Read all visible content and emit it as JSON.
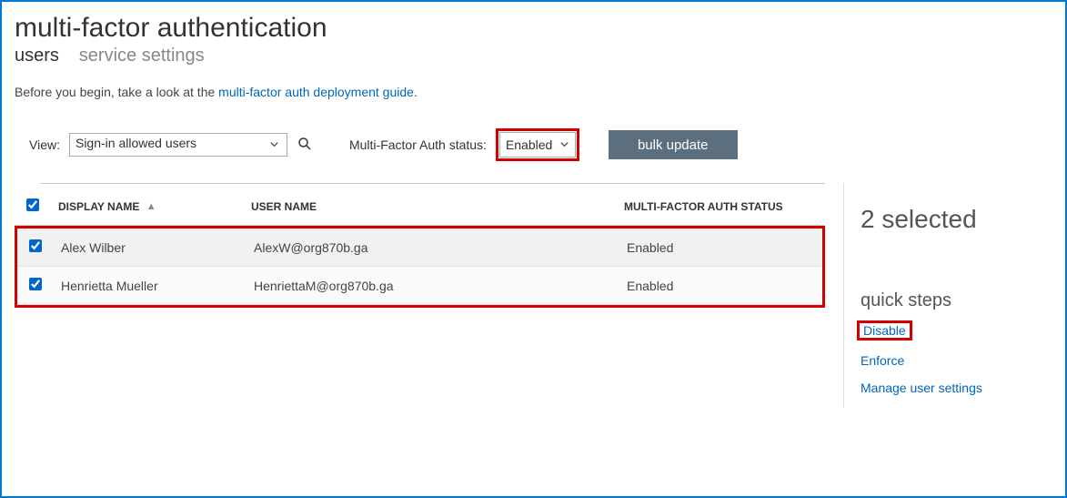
{
  "page": {
    "title": "multi-factor authentication",
    "tabs": {
      "users": "users",
      "service_settings": "service settings"
    },
    "intro_prefix": "Before you begin, take a look at the ",
    "intro_link": "multi-factor auth deployment guide",
    "intro_suffix": "."
  },
  "filters": {
    "view_label": "View:",
    "view_value": "Sign-in allowed users",
    "status_label": "Multi-Factor Auth status:",
    "status_value": "Enabled",
    "bulk_update": "bulk update"
  },
  "table": {
    "headers": {
      "display_name": "DISPLAY NAME",
      "user_name": "USER NAME",
      "mfa_status": "MULTI-FACTOR AUTH STATUS"
    },
    "rows": [
      {
        "display_name": "Alex Wilber",
        "user_name": "AlexW@org870b.ga",
        "status": "Enabled"
      },
      {
        "display_name": "Henrietta Mueller",
        "user_name": "HenriettaM@org870b.ga",
        "status": "Enabled"
      }
    ]
  },
  "sidebar": {
    "selected": "2 selected",
    "quick_steps_title": "quick steps",
    "links": {
      "disable": "Disable",
      "enforce": "Enforce",
      "manage": "Manage user settings"
    }
  }
}
